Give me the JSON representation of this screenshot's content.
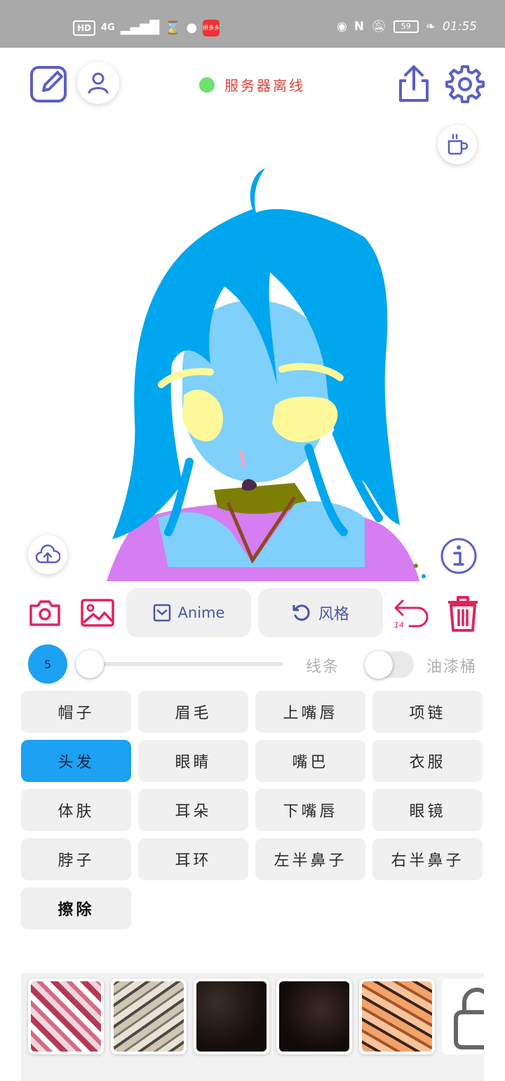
{
  "status_bar": {
    "indicators": [
      "HD",
      "4G"
    ],
    "app_badge": "拼多多",
    "time": "01:55",
    "battery": "59"
  },
  "header": {
    "server_status": "服务器离线",
    "server_status_color": "#6de26d"
  },
  "canvas": {
    "hair_color": "#00a6ee",
    "skin_color": "#7fd0fa",
    "eye_color": "#fdf99a",
    "neck_color": "#7d7f05",
    "clothes_color": "#d77df2"
  },
  "toolbar": {
    "model_button": "Anime",
    "style_button": "风格",
    "undo_count": "14"
  },
  "brush": {
    "size": "5",
    "size_value": 0,
    "line_label": "线条",
    "bucket_label": "油漆桶",
    "bucket_enabled": false
  },
  "parts": [
    {
      "label": "帽子",
      "active": false
    },
    {
      "label": "眉毛",
      "active": false
    },
    {
      "label": "上嘴唇",
      "active": false
    },
    {
      "label": "项链",
      "active": false
    },
    {
      "label": "头发",
      "active": true
    },
    {
      "label": "眼睛",
      "active": false
    },
    {
      "label": "嘴巴",
      "active": false
    },
    {
      "label": "衣服",
      "active": false
    },
    {
      "label": "体肤",
      "active": false
    },
    {
      "label": "耳朵",
      "active": false
    },
    {
      "label": "下嘴唇",
      "active": false
    },
    {
      "label": "眼镜",
      "active": false
    },
    {
      "label": "脖子",
      "active": false
    },
    {
      "label": "耳环",
      "active": false
    },
    {
      "label": "左半鼻子",
      "active": false
    },
    {
      "label": "右半鼻子",
      "active": false
    },
    {
      "label": "擦除",
      "active": false
    }
  ],
  "textures": [
    {
      "name": "red-white-marble"
    },
    {
      "name": "grey-ink-wash"
    },
    {
      "name": "dark-leather"
    },
    {
      "name": "dark-leather-2"
    },
    {
      "name": "orange-tiger"
    },
    {
      "name": "locked"
    }
  ],
  "colors": {
    "accent": "#1da1f2",
    "icon_purple": "#5b5fc7",
    "danger": "#e0245e"
  }
}
